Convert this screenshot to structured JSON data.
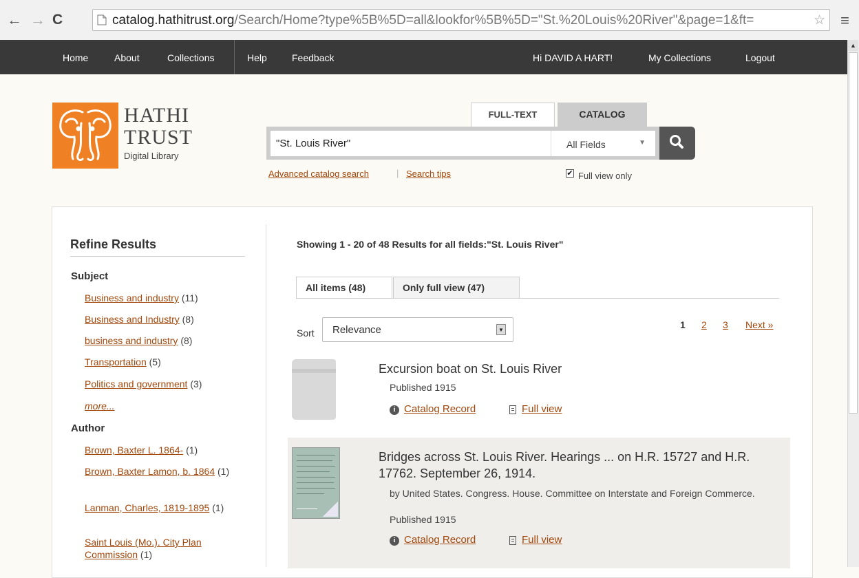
{
  "browser": {
    "url_host": "catalog.hathitrust.org",
    "url_path": "/Search/Home?type%5B%5D=all&lookfor%5B%5D=\"St.%20Louis%20River\"&page=1&ft="
  },
  "topnav": {
    "home": "Home",
    "about": "About",
    "collections": "Collections",
    "help": "Help",
    "feedback": "Feedback",
    "greeting": "Hi DAVID A HART!",
    "my_collections": "My Collections",
    "logout": "Logout"
  },
  "logo": {
    "line1": "HATHI",
    "line2": "TRUST",
    "line3": "Digital Library"
  },
  "search": {
    "tab_fulltext": "FULL-TEXT",
    "tab_catalog": "CATALOG",
    "query": "\"St. Louis River\"",
    "field": "All Fields",
    "advanced": "Advanced catalog search",
    "divider": "|",
    "tips": "Search tips",
    "full_view_only": "Full view only",
    "full_view_checked": true
  },
  "sidebar": {
    "title": "Refine Results",
    "subject_heading": "Subject",
    "subjects": [
      {
        "label": "Business and industry",
        "count": "(11)"
      },
      {
        "label": "Business and Industry",
        "count": "(8)"
      },
      {
        "label": "business and industry",
        "count": "(8)"
      },
      {
        "label": "Transportation",
        "count": "(5)"
      },
      {
        "label": "Politics and government",
        "count": "(3)"
      }
    ],
    "more": "more...",
    "author_heading": "Author",
    "authors": [
      {
        "label": "Brown, Baxter L. 1864-",
        "count": "(1)"
      },
      {
        "label": "Brown, Baxter Lamon, b. 1864",
        "count": "(1)"
      },
      {
        "label": "Lanman, Charles, 1819-1895",
        "count": "(1)"
      },
      {
        "label": "Saint Louis (Mo.). City Plan Commission",
        "count": "(1)"
      }
    ]
  },
  "results": {
    "summary": "Showing 1 - 20 of 48 Results for all fields:\"St. Louis River\"",
    "tab_all": "All items (48)",
    "tab_full": "Only full view (47)",
    "sort_label": "Sort",
    "sort_value": "Relevance",
    "pages": [
      "1",
      "2",
      "3"
    ],
    "next": "Next »",
    "catalog_record": "Catalog Record",
    "full_view": "Full view",
    "items": [
      {
        "title": "Excursion boat on St. Louis River",
        "published": "Published 1915"
      },
      {
        "title": "Bridges across St. Louis River. Hearings ... on H.R. 15727 and H.R. 17762. September 26, 1914.",
        "author": "by United States. Congress. House. Committee on Interstate and Foreign Commerce.",
        "published": "Published 1915"
      }
    ]
  }
}
